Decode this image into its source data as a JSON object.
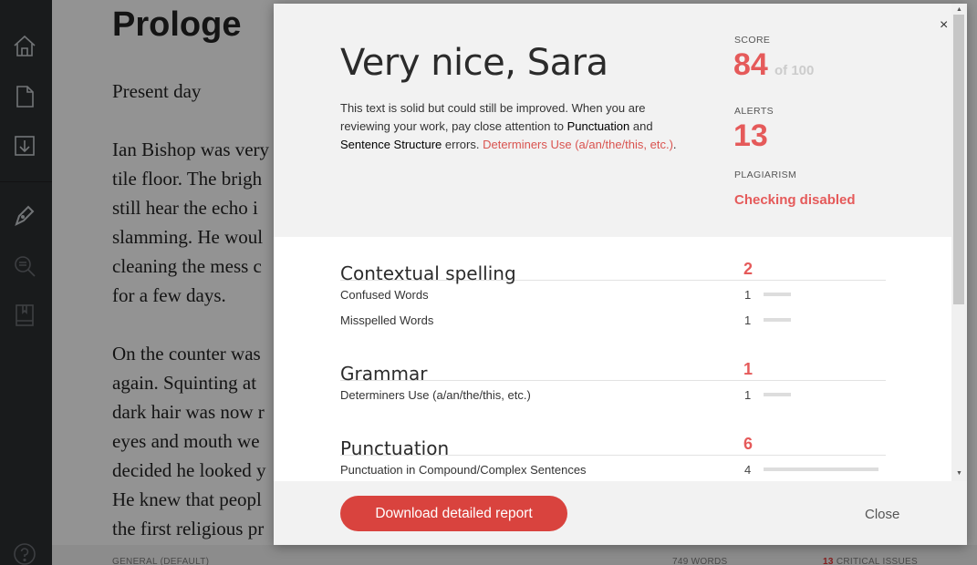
{
  "sidebar": {
    "icons": [
      "home-icon",
      "document-icon",
      "download-icon",
      "pen-icon",
      "search-document-icon",
      "book-icon",
      "help-icon"
    ]
  },
  "editor": {
    "title": "Prologe",
    "paragraphs": [
      "Present day",
      "Ian Bishop was very\ntile floor. The brigh\nstill hear the echo i\nslamming. He woul\ncleaning the mess c\nfor a few days.",
      "On the counter was\nagain. Squinting at \ndark hair was now r\neyes and mouth we\ndecided he looked y\nHe knew that peopl\nthe first religious pr"
    ]
  },
  "statusbar": {
    "profile": "General (Default)",
    "words": "749 words",
    "critical_count": "13",
    "critical_label": "critical issues"
  },
  "report": {
    "greeting": "Very nice, Sara",
    "summary": {
      "part1": "This text is solid but could still be improved. When you are reviewing your work, pay close attention to ",
      "hl1": "Punctuation",
      "part2": " and ",
      "hl2": "Sentence Structure",
      "part3": " errors. ",
      "red": "Determiners Use (a/an/the/this, etc.)",
      "part4": "."
    },
    "score_label": "SCORE",
    "score_value": "84",
    "score_of": "of 100",
    "alerts_label": "ALERTS",
    "alerts_value": "13",
    "plagiarism_label": "PLAGIARISM",
    "plagiarism_value": "Checking disabled",
    "categories": [
      {
        "name": "Contextual spelling",
        "count": "2",
        "items": [
          {
            "name": "Confused Words",
            "count": "1",
            "bar": 0.24
          },
          {
            "name": "Misspelled Words",
            "count": "1",
            "bar": 0.24
          }
        ]
      },
      {
        "name": "Grammar",
        "count": "1",
        "items": [
          {
            "name": "Determiners Use (a/an/the/this, etc.)",
            "count": "1",
            "bar": 0.24
          }
        ]
      },
      {
        "name": "Punctuation",
        "count": "6",
        "items": [
          {
            "name": "Punctuation in Compound/Complex Sentences",
            "count": "4",
            "bar": 1.0
          }
        ]
      }
    ],
    "download_label": "Download detailed report",
    "close_label": "Close",
    "close_x": "×"
  }
}
